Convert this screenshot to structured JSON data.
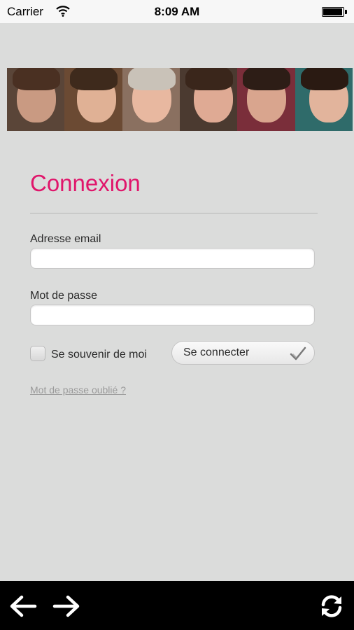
{
  "status_bar": {
    "carrier": "Carrier",
    "time": "8:09 AM",
    "wifi_icon": "wifi-icon",
    "battery_icon": "battery-icon"
  },
  "banner": {
    "photos": [
      "photo-1",
      "photo-2",
      "photo-3",
      "photo-4",
      "photo-5",
      "photo-6"
    ]
  },
  "login": {
    "title": "Connexion",
    "email_label": "Adresse email",
    "email_value": "",
    "password_label": "Mot de passe",
    "password_value": "",
    "remember_label": "Se souvenir de moi",
    "remember_checked": false,
    "submit_label": "Se connecter",
    "submit_icon": "check-icon",
    "forgot_link": "Mot de passe oublié ?"
  },
  "toolbar": {
    "back_icon": "arrow-left-icon",
    "forward_icon": "arrow-right-icon",
    "refresh_icon": "refresh-icon"
  },
  "colors": {
    "accent": "#e0166b",
    "background": "#dbdcdb",
    "toolbar": "#000000",
    "link": "#9a9a9a"
  }
}
